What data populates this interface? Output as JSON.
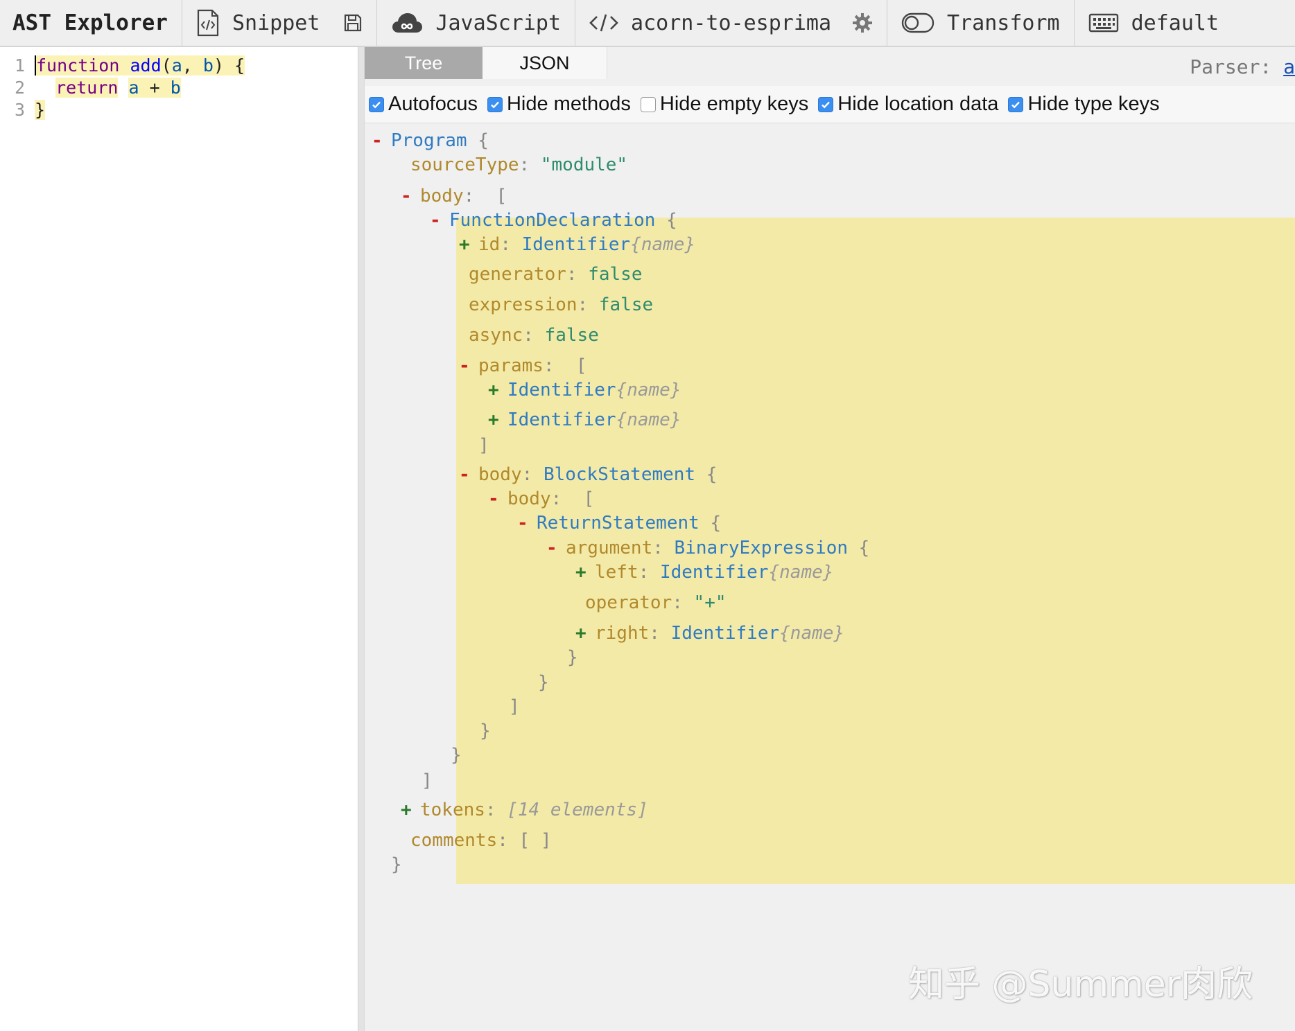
{
  "toolbar": {
    "title": "AST Explorer",
    "snippet_label": "Snippet",
    "language_label": "JavaScript",
    "parser_label": "acorn-to-esprima",
    "transform_label": "Transform",
    "keymap_label": "default"
  },
  "editor": {
    "lines": [
      {
        "no": "1",
        "tokens": [
          [
            "kw",
            "function"
          ],
          [
            "sp",
            " "
          ],
          [
            "fn",
            "add"
          ],
          [
            "pu",
            "("
          ],
          [
            "pa",
            "a"
          ],
          [
            "pu",
            ", "
          ],
          [
            "pa",
            "b"
          ],
          [
            "pu",
            ") {"
          ]
        ]
      },
      {
        "no": "2",
        "tokens": [
          [
            "sp",
            "  "
          ],
          [
            "kw",
            "return"
          ],
          [
            "sp",
            " "
          ],
          [
            "vr",
            "a"
          ],
          [
            "pu",
            " + "
          ],
          [
            "vr",
            "b"
          ]
        ]
      },
      {
        "no": "3",
        "tokens": [
          [
            "pu",
            "}"
          ]
        ]
      }
    ]
  },
  "panel": {
    "tabs": [
      "Tree",
      "JSON"
    ],
    "active_tab": "Tree",
    "parser_prefix": "Parser: ",
    "parser_link": "a"
  },
  "options": [
    {
      "label": "Autofocus",
      "checked": true
    },
    {
      "label": "Hide methods",
      "checked": true
    },
    {
      "label": "Hide empty keys",
      "checked": false
    },
    {
      "label": "Hide location data",
      "checked": true
    },
    {
      "label": "Hide type keys",
      "checked": true
    }
  ],
  "tree": [
    {
      "toggle": "-",
      "key": "",
      "type": "Program",
      "suffix": " {"
    },
    {
      "toggle": "",
      "key": "sourceType",
      "value": "\"module\"",
      "vclass": "str"
    },
    {
      "toggle": "-",
      "key": "body",
      "suffix": " ["
    },
    {
      "toggle": "-",
      "key": "",
      "type": "FunctionDeclaration",
      "suffix": " {"
    },
    {
      "toggle": "+",
      "key": "id",
      "type": "Identifier",
      "meta": "{name}"
    },
    {
      "toggle": "",
      "key": "generator",
      "value": "false",
      "vclass": "bool"
    },
    {
      "toggle": "",
      "key": "expression",
      "value": "false",
      "vclass": "bool"
    },
    {
      "toggle": "",
      "key": "async",
      "value": "false",
      "vclass": "bool"
    },
    {
      "toggle": "-",
      "key": "params",
      "suffix": " ["
    },
    {
      "toggle": "+",
      "key": "",
      "type": "Identifier",
      "meta": "{name}"
    },
    {
      "toggle": "+",
      "key": "",
      "type": "Identifier",
      "meta": "{name}"
    },
    {
      "toggle": "",
      "close": "]"
    },
    {
      "toggle": "-",
      "key": "body",
      "type": "BlockStatement",
      "suffix": " {"
    },
    {
      "toggle": "-",
      "key": "body",
      "suffix": " ["
    },
    {
      "toggle": "-",
      "key": "",
      "type": "ReturnStatement",
      "suffix": " {"
    },
    {
      "toggle": "-",
      "key": "argument",
      "type": "BinaryExpression",
      "suffix": " {"
    },
    {
      "toggle": "+",
      "key": "left",
      "type": "Identifier",
      "meta": "{name}"
    },
    {
      "toggle": "",
      "key": "operator",
      "value": "\"+\"",
      "vclass": "str"
    },
    {
      "toggle": "+",
      "key": "right",
      "type": "Identifier",
      "meta": "{name}"
    },
    {
      "toggle": "",
      "close": "}"
    },
    {
      "toggle": "",
      "close": "}"
    },
    {
      "toggle": "",
      "close": "]"
    },
    {
      "toggle": "",
      "close": "}"
    },
    {
      "toggle": "",
      "close": "}"
    },
    {
      "toggle": "",
      "close": "]"
    },
    {
      "toggle": "+",
      "key": "tokens",
      "meta": "[14 elements]"
    },
    {
      "toggle": "",
      "key": "comments",
      "value": "[ ]",
      "vclass": "punc"
    },
    {
      "toggle": "",
      "close": "}"
    }
  ],
  "watermark": "知乎 @Summer肉欣",
  "colors": {
    "highlight": "#f4eaa8",
    "accent": "#3b8ff0"
  }
}
